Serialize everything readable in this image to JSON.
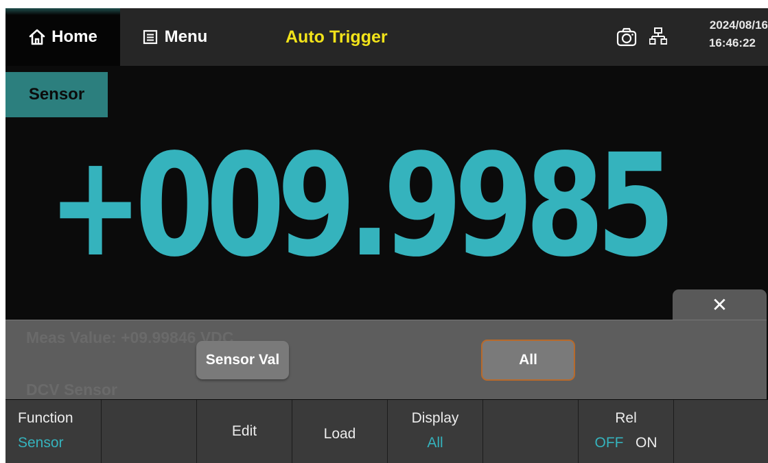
{
  "header": {
    "home_label": "Home",
    "menu_label": "Menu",
    "trigger_mode": "Auto Trigger",
    "date": "2024/08/16",
    "time": "16:46:22"
  },
  "sensor_tag": "Sensor",
  "reading": "+009.9985",
  "panel": {
    "meas_value": "Meas Value: +09.99846 VDC",
    "sensor_type": "DCV Sensor",
    "options": [
      "Sensor Val",
      "All"
    ],
    "selected_option": "All"
  },
  "softkeys": [
    {
      "label": "Function",
      "value": "Sensor"
    },
    {
      "label": "",
      "value": ""
    },
    {
      "label": "Edit",
      "value": ""
    },
    {
      "label": "Load",
      "value": ""
    },
    {
      "label": "Display",
      "value": "All"
    },
    {
      "label": "",
      "value": ""
    },
    {
      "label": "Rel",
      "value_off": "OFF",
      "value_on": "ON",
      "active": "OFF"
    },
    {
      "label": "",
      "value": ""
    }
  ],
  "colors": {
    "accent_teal": "#35b3bd",
    "trigger_yellow": "#f2e31a",
    "selected_border": "#b86a2b"
  },
  "icons": [
    "home-icon",
    "menu-list-icon",
    "camera-icon",
    "network-icon",
    "close-icon"
  ]
}
